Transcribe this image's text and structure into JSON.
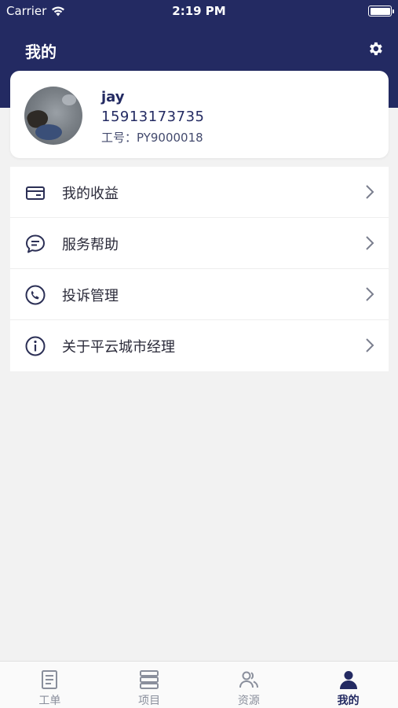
{
  "status_bar": {
    "carrier": "Carrier",
    "time": "2:19 PM"
  },
  "header": {
    "title": "我的"
  },
  "profile": {
    "name": "jay",
    "phone": "15913173735",
    "employee_id": "工号：PY9000018"
  },
  "menu": {
    "items": [
      {
        "label": "我的收益",
        "icon": "card-icon"
      },
      {
        "label": "服务帮助",
        "icon": "chat-icon"
      },
      {
        "label": "投诉管理",
        "icon": "phone-icon"
      },
      {
        "label": "关于平云城市经理",
        "icon": "info-icon"
      }
    ]
  },
  "tabbar": {
    "tabs": [
      {
        "label": "工单",
        "icon": "document-icon",
        "active": false
      },
      {
        "label": "项目",
        "icon": "stack-icon",
        "active": false
      },
      {
        "label": "资源",
        "icon": "users-icon",
        "active": false
      },
      {
        "label": "我的",
        "icon": "person-icon",
        "active": true
      }
    ]
  },
  "colors": {
    "header_bg": "#232a62",
    "page_bg": "#f2f2f2",
    "accent": "#232a62",
    "inactive_tab": "#8a8f9c"
  }
}
